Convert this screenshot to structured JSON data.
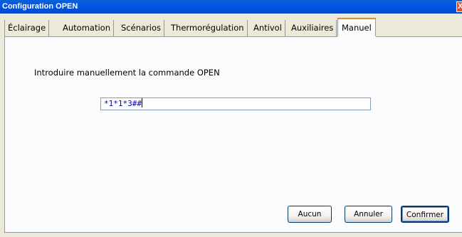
{
  "window": {
    "title": "Configuration OPEN",
    "close_label": "X"
  },
  "tabs": [
    {
      "label": "Éclairage",
      "active": false
    },
    {
      "label": "Automation",
      "active": false
    },
    {
      "label": "Scénarios",
      "active": false
    },
    {
      "label": "Thermorégulation",
      "active": false
    },
    {
      "label": "Antivol",
      "active": false
    },
    {
      "label": "Auxiliaires",
      "active": false
    },
    {
      "label": "Manuel",
      "active": true
    }
  ],
  "manual": {
    "instruction": "Introduire manuellement la commande OPEN",
    "command_value": "*1*1*3##"
  },
  "buttons": {
    "none_label": "Aucun",
    "cancel_label": "Annuler",
    "confirm_label": "Confirmer"
  },
  "colors": {
    "titlebar": "#0058E6",
    "active_tab_accent": "#E68B2C",
    "input_text": "#0000B0"
  }
}
